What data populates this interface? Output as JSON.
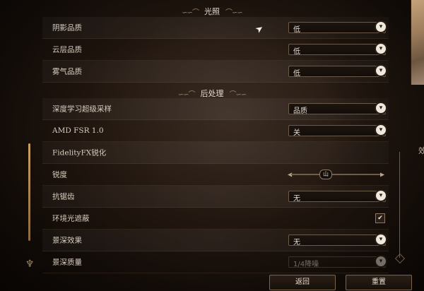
{
  "sections": {
    "lighting": {
      "title": "光照"
    },
    "post_processing": {
      "title": "后处理"
    }
  },
  "rows": [
    {
      "label": "阴影品质",
      "control": "dropdown",
      "value": "低"
    },
    {
      "label": "云层品质",
      "control": "dropdown",
      "value": "低"
    },
    {
      "label": "雾气品质",
      "control": "dropdown",
      "value": "低"
    },
    {
      "label": "深度学习超级采样",
      "control": "dropdown",
      "value": "品质"
    },
    {
      "label": "AMD FSR 1.0",
      "control": "dropdown",
      "value": "关"
    },
    {
      "label": "FidelityFX锐化",
      "control": "none"
    },
    {
      "label": "锐度",
      "control": "slider",
      "thumb_glyph": "山"
    },
    {
      "label": "抗锯齿",
      "control": "dropdown",
      "value": "无"
    },
    {
      "label": "环境光遮蔽",
      "control": "checkbox",
      "checked": true,
      "check_glyph": "✔"
    },
    {
      "label": "景深效果",
      "control": "dropdown",
      "value": "无"
    },
    {
      "label": "景深质量",
      "control": "dropdown",
      "value": "1/4降噪",
      "disabled": true
    }
  ],
  "buttons": {
    "back": "返回",
    "reset": "重置"
  },
  "right_edge_text": "效",
  "icons": {
    "dropdown_chevron": "chevron-down-icon",
    "cursor": "gauntlet-cursor-icon",
    "emblem": "crest-emblem-icon"
  },
  "colors": {
    "accent_gold": "#c9a062",
    "text": "#d8cdbf",
    "background": "#21160f"
  }
}
